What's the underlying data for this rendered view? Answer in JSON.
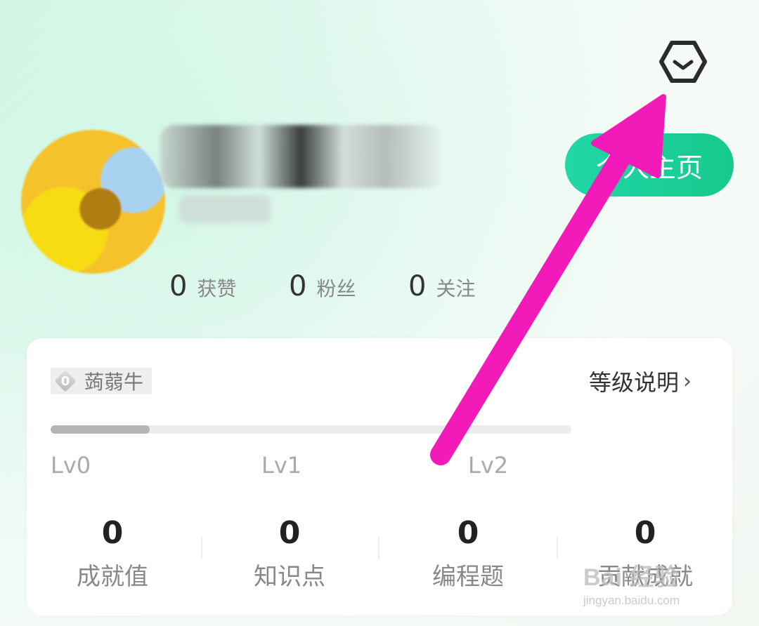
{
  "profile": {
    "home_button_label": "个人主页",
    "stats": [
      {
        "value": "0",
        "label": "获赞"
      },
      {
        "value": "0",
        "label": "粉丝"
      },
      {
        "value": "0",
        "label": "关注"
      }
    ]
  },
  "level_card": {
    "badge": {
      "digit": "0",
      "name": "蒟蒻牛"
    },
    "level_link": "等级说明",
    "progress_fraction": 0.19,
    "levels": [
      "Lv0",
      "Lv1",
      "Lv2"
    ],
    "metrics": [
      {
        "value": "0",
        "label": "成就值"
      },
      {
        "value": "0",
        "label": "知识点"
      },
      {
        "value": "0",
        "label": "编程题"
      },
      {
        "value": "0",
        "label": "贡献成就"
      }
    ]
  },
  "watermark": {
    "line1": "Bai 经验",
    "line2": "jingyan.baidu.com"
  },
  "colors": {
    "accent": "#16c98d",
    "arrow": "#f21bb9"
  }
}
